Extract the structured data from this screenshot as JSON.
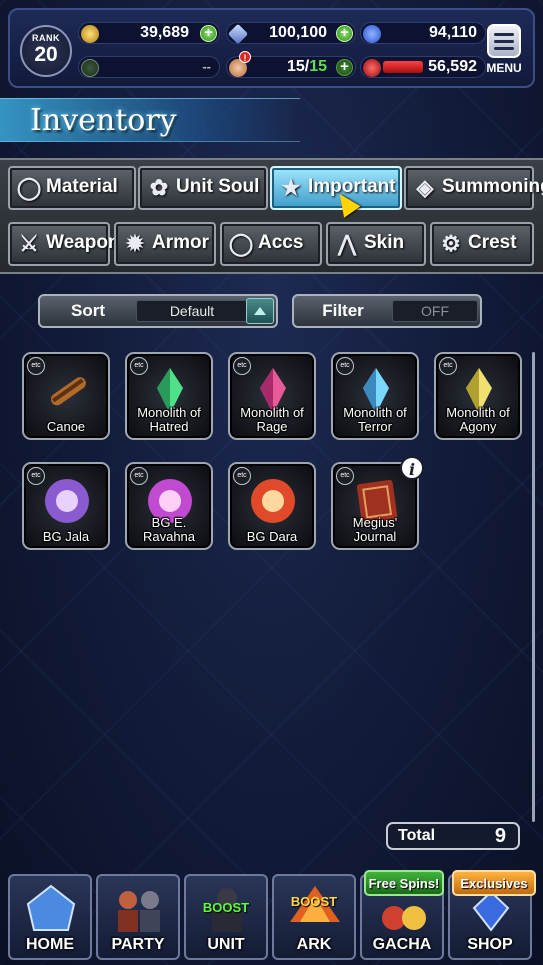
{
  "hud": {
    "rank_label": "RANK",
    "rank_value": "20",
    "gil": "39,689",
    "crystals": "100,100",
    "orbs": "94,110",
    "lapis": "--",
    "stamina_current": "15/",
    "stamina_max": "15",
    "energy": "56,592",
    "menu_label": "MENU",
    "alert": "!"
  },
  "title": "Inventory",
  "tabs": {
    "row1": [
      {
        "label": "Material",
        "icon": "bag-icon"
      },
      {
        "label": "Unit Soul",
        "icon": "soul-icon"
      },
      {
        "label": "Important",
        "icon": "star-icon",
        "active": true
      },
      {
        "label": "Summoning",
        "icon": "summon-icon"
      }
    ],
    "row2": [
      {
        "label": "Weapon",
        "icon": "sword-icon"
      },
      {
        "label": "Armor",
        "icon": "armor-icon"
      },
      {
        "label": "Accs",
        "icon": "accessory-icon"
      },
      {
        "label": "Skin",
        "icon": "hanger-icon"
      },
      {
        "label": "Crest",
        "icon": "crest-icon"
      }
    ]
  },
  "sort": {
    "label": "Sort",
    "value": "Default"
  },
  "filter": {
    "label": "Filter",
    "value": "OFF"
  },
  "item_tag": "etc",
  "items": [
    {
      "name": "Canoe",
      "color": "#b06a2a"
    },
    {
      "name": "Monolith of Hatred",
      "color": "#4fe08a"
    },
    {
      "name": "Monolith of Rage",
      "color": "#e85a9a"
    },
    {
      "name": "Monolith of Terror",
      "color": "#7ad8ff"
    },
    {
      "name": "Monolith of Agony",
      "color": "#f0e070"
    },
    {
      "name": "BG Jala",
      "color": "#8a5ad0"
    },
    {
      "name": "BG E. Ravahna",
      "color": "#c04ad0"
    },
    {
      "name": "BG Dara",
      "color": "#e04a2a"
    },
    {
      "name": "Megius' Journal",
      "color": "#a03020"
    }
  ],
  "info_icon": "i",
  "total": {
    "label": "Total",
    "value": "9"
  },
  "nav": [
    {
      "label": "HOME",
      "icon": "home-icon"
    },
    {
      "label": "PARTY",
      "icon": "party-icon"
    },
    {
      "label": "UNIT",
      "icon": "unit-icon",
      "boost": "BOOST"
    },
    {
      "label": "ARK",
      "icon": "ark-icon",
      "boost": "BOOST"
    },
    {
      "label": "GACHA",
      "icon": "gacha-icon",
      "pill": "Free Spins!"
    },
    {
      "label": "SHOP",
      "icon": "shop-icon",
      "pill": "Exclusives"
    }
  ]
}
